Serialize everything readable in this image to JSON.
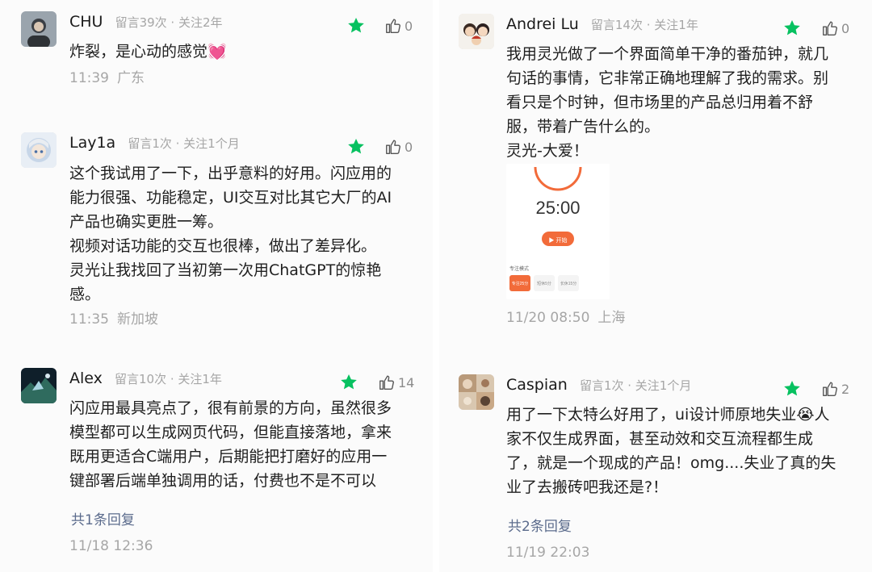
{
  "comments": [
    {
      "nickname": "CHU",
      "meta": "留言39次 · 关注2年",
      "likes": "0",
      "text": "炸裂，是心动的感觉💓",
      "time": "11:39",
      "location": "广东",
      "avatar": "avatar-portrait"
    },
    {
      "nickname": "Lay1a",
      "meta": "留言1次 · 关注1个月",
      "likes": "0",
      "text": "这个我试用了一下，出乎意料的好用。闪应用的\n能力很强、功能稳定，UI交互对比其它大厂的AI\n产品也确实更胜一筹。\n视频对话功能的交互也很棒，做出了差异化。\n灵光让我找回了当初第一次用ChatGPT的惊艳\n感。",
      "time": "11:35",
      "location": "新加坡",
      "avatar": "avatar-anime-girl"
    },
    {
      "nickname": "Alex",
      "meta": "留言10次 · 关注1年",
      "likes": "14",
      "text": "闪应用最具亮点了，很有前景的方向，虽然很多\n模型都可以生成网页代码，但能直接落地，拿来\n既用更适合C端用户，后期能把打磨好的应用一\n键部署后端单独调用的话，付费也不是不可以",
      "replies": "共1条回复",
      "time": "11/18 12:36",
      "location": "",
      "avatar": "avatar-landscape"
    },
    {
      "nickname": "Andrei Lu",
      "meta": "留言14次 · 关注1年",
      "likes": "0",
      "text": "我用灵光做了一个界面简单干净的番茄钟，就几\n句话的事情，它非常正确地理解了我的需求。别\n看只是个时钟，但市场里的产品总归用着不舒\n服，带着广告什么的。\n灵光-大爱！",
      "screenshot": {
        "timer": "25:00",
        "start_button": "▶ 开始",
        "mode_label": "专注模式",
        "options": [
          "专注25分",
          "短休5分",
          "长休15分"
        ]
      },
      "time": "11/20 08:50",
      "location": "上海",
      "avatar": "avatar-cartoon-family"
    },
    {
      "nickname": "Caspian",
      "meta": "留言1次 · 关注1个月",
      "likes": "2",
      "text": "用了一下太特么好用了，ui设计师原地失业😭人\n家不仅生成界面，甚至动效和交互流程都生成\n了，就是一个现成的产品！omg....失业了真的失\n业了去搬砖吧我还是?！",
      "replies": "共2条回复",
      "time": "11/19 22:03",
      "location": "",
      "avatar": "avatar-cats"
    }
  ],
  "colors": {
    "star": "#07c160",
    "reply_link": "#5b6b8c",
    "meta_gray": "#a6a6a6",
    "timer_accent": "#f26b3a"
  }
}
